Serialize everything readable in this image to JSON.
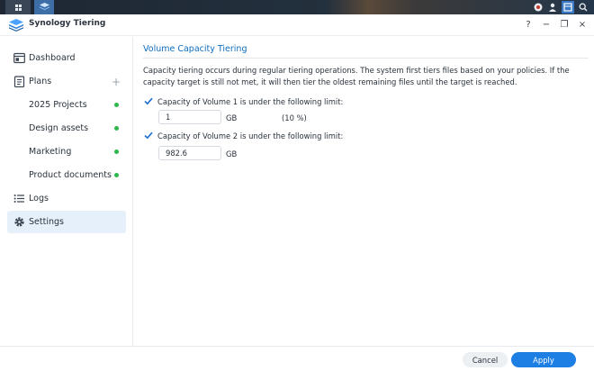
{
  "window": {
    "title": "Synology Tiering",
    "controls": {
      "help": "?",
      "minimize": "−",
      "restore": "❐",
      "close": "×"
    }
  },
  "sidebar": {
    "items": [
      {
        "label": "Dashboard",
        "icon": "dashboard-icon"
      },
      {
        "label": "Plans",
        "icon": "plans-icon",
        "add": "+"
      },
      {
        "label": "2025 Projects",
        "status_color": "#2db84b"
      },
      {
        "label": "Design assets",
        "status_color": "#2db84b"
      },
      {
        "label": "Marketing",
        "status_color": "#2db84b"
      },
      {
        "label": "Product documents",
        "status_color": "#2db84b"
      },
      {
        "label": "Logs",
        "icon": "logs-icon"
      },
      {
        "label": "Settings",
        "icon": "gear-icon",
        "active": true
      }
    ]
  },
  "main": {
    "section_title": "Volume Capacity Tiering",
    "description": "Capacity tiering occurs during regular tiering operations. The system first tiers files based on your policies. If the capacity target is still not met, it will then tier the oldest remaining files until the target is reached.",
    "volume1": {
      "checked": true,
      "label": "Capacity of Volume 1 is under the following limit:",
      "value": "1",
      "unit": "GB",
      "percent": "(10 %)"
    },
    "volume2": {
      "checked": true,
      "label": "Capacity of Volume 2 is under the following limit:",
      "value": "982.6",
      "unit": "GB"
    }
  },
  "footer": {
    "cancel_label": "Cancel",
    "apply_label": "Apply"
  },
  "colors": {
    "accent": "#1d7ee4",
    "title_blue": "#0f6cbd",
    "status_green": "#2db84b",
    "active_bg": "#e5f0fa"
  }
}
